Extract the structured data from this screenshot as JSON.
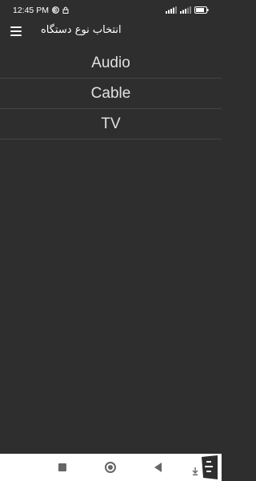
{
  "status_bar": {
    "time": "12:45 PM",
    "icons": [
      "e-icon",
      "lock-icon",
      "signal-icon",
      "signal-icon",
      "battery-icon"
    ]
  },
  "app_bar": {
    "title": "انتخاب نوع دستگاه",
    "menu_icon": "menu-icon"
  },
  "device_types": [
    {
      "label": "Audio"
    },
    {
      "label": "Cable"
    },
    {
      "label": "TV"
    }
  ],
  "nav_bar": {
    "icons": [
      "recent-apps-icon",
      "home-icon",
      "back-icon",
      "accessibility-icon"
    ]
  },
  "colors": {
    "background": "#2e2e2e",
    "divider": "#444444",
    "nav_background": "#ffffff"
  }
}
